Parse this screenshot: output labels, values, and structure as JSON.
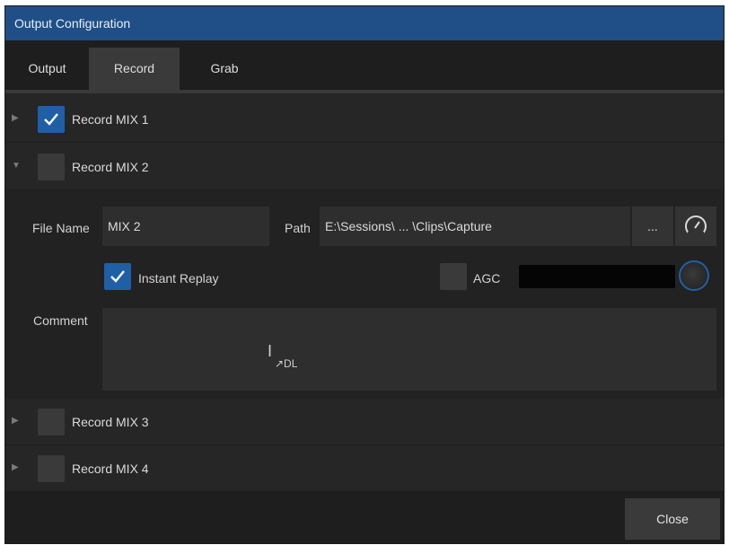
{
  "window": {
    "title": "Output Configuration"
  },
  "tabs": [
    {
      "label": "Output",
      "active": false
    },
    {
      "label": "Record",
      "active": true
    },
    {
      "label": "Grab",
      "active": false
    }
  ],
  "records": [
    {
      "label": "Record MIX 1",
      "checked": true,
      "expanded": false
    },
    {
      "label": "Record MIX 2",
      "checked": false,
      "expanded": true
    },
    {
      "label": "Record MIX 3",
      "checked": false,
      "expanded": false
    },
    {
      "label": "Record MIX 4",
      "checked": false,
      "expanded": false
    }
  ],
  "mix2": {
    "file_name_label": "File Name",
    "file_name_value": "MIX 2",
    "path_label": "Path",
    "path_value": "E:\\Sessions\\ ... \\Clips\\Capture",
    "browse_label": "...",
    "instant_replay_label": "Instant Replay",
    "instant_replay_checked": true,
    "agc_label": "AGC",
    "agc_checked": false,
    "comment_label": "Comment",
    "comment_value": ""
  },
  "cursor_text": "↗DL",
  "footer": {
    "close_label": "Close"
  },
  "colors": {
    "accent": "#1f5fa6",
    "titlebar": "#1f4f86",
    "background": "#262626"
  }
}
